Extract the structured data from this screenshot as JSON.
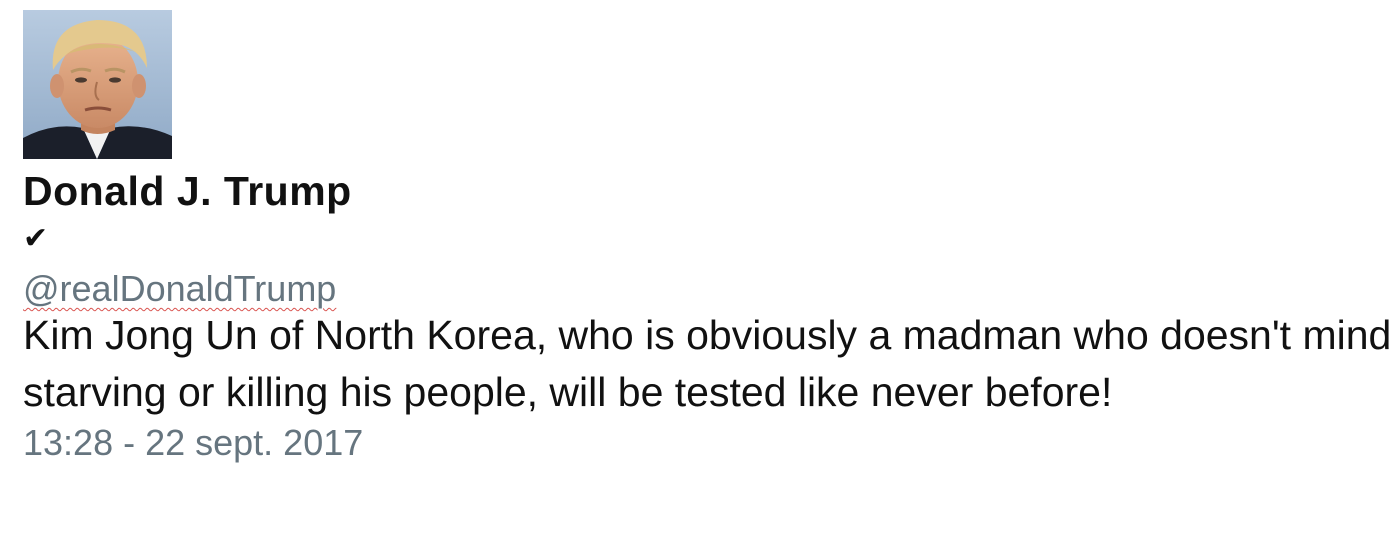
{
  "tweet": {
    "avatar_icon": "profile-photo",
    "display_name": "Donald J. Trump",
    "verified_glyph": "✔",
    "handle": "@realDonaldTrump",
    "text": "Kim Jong Un of North Korea, who is obviously a madman who doesn't mind starving or killing his people, will be tested like never before!",
    "timestamp": "13:28 - 22 sept. 2017"
  },
  "colors": {
    "text": "#111111",
    "muted": "#66757f",
    "spellcheck_underline": "#d9534f"
  }
}
